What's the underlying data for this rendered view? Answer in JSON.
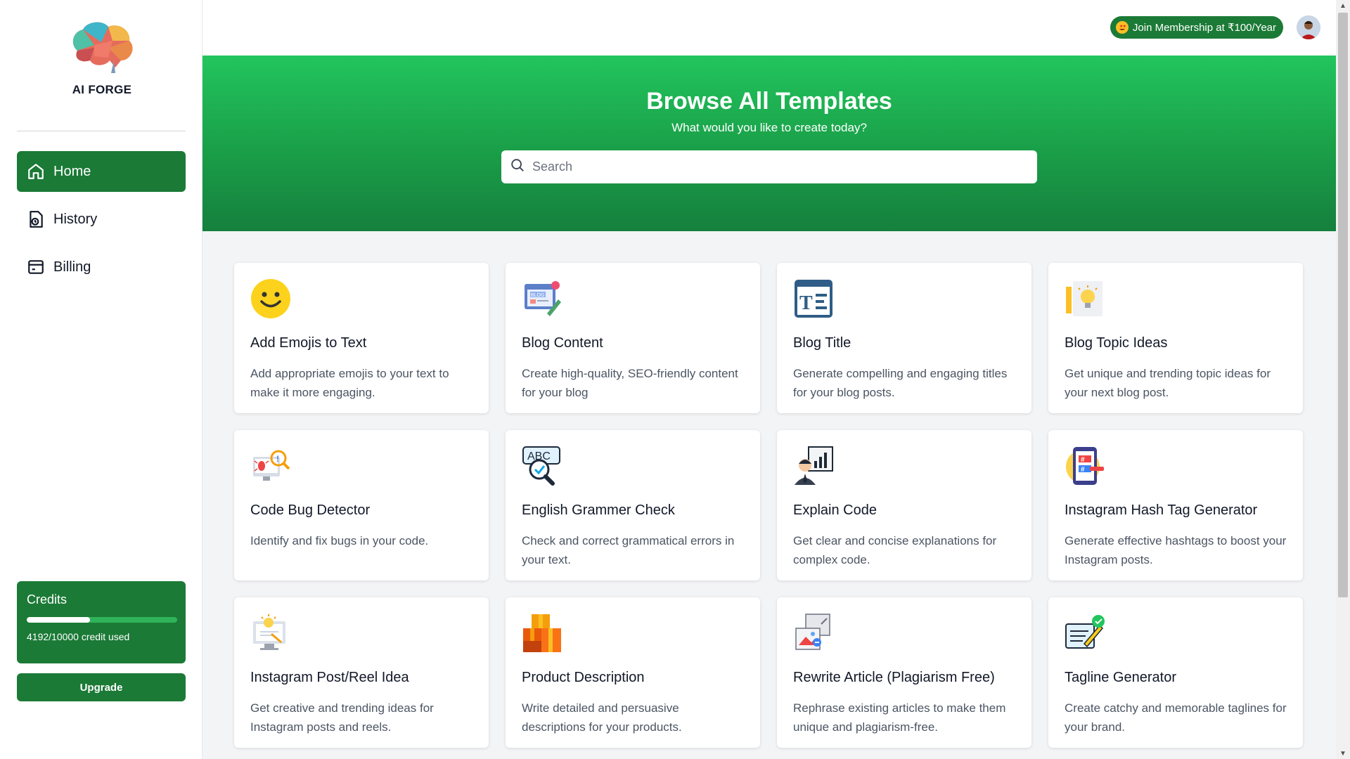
{
  "app": {
    "name": "AI FORGE"
  },
  "sidebar": {
    "items": [
      {
        "label": "Home",
        "icon": "home-icon",
        "active": true
      },
      {
        "label": "History",
        "icon": "history-icon",
        "active": false
      },
      {
        "label": "Billing",
        "icon": "billing-icon",
        "active": false
      }
    ],
    "credits": {
      "title": "Credits",
      "used_text": "4192/10000 credit used",
      "progress": 0.419
    },
    "upgrade_label": "Upgrade"
  },
  "topbar": {
    "membership_label": "Join Membership at ₹100/Year"
  },
  "hero": {
    "title": "Browse All Templates",
    "subtitle": "What would you like to create today?",
    "search_placeholder": "Search"
  },
  "colors": {
    "primary": "#1b7a36",
    "hero_start": "#22c55e",
    "hero_end": "#15803d"
  },
  "templates": [
    {
      "title": "Add Emojis to Text",
      "desc": "Add appropriate emojis to your text to make it more engaging.",
      "icon": "smiley-icon"
    },
    {
      "title": "Blog Content",
      "desc": "Create high-quality, SEO-friendly content for your blog",
      "icon": "blog-icon"
    },
    {
      "title": "Blog Title",
      "desc": "Generate compelling and engaging titles for your blog posts.",
      "icon": "title-icon"
    },
    {
      "title": "Blog Topic Ideas",
      "desc": "Get unique and trending topic ideas for your next blog post.",
      "icon": "lightbulb-icon"
    },
    {
      "title": "Code Bug Detector",
      "desc": "Identify and fix bugs in your code.",
      "icon": "bug-icon"
    },
    {
      "title": "English Grammer Check",
      "desc": "Check and correct grammatical errors in your text.",
      "icon": "abc-magnifier-icon"
    },
    {
      "title": "Explain Code",
      "desc": "Get clear and concise explanations for complex code.",
      "icon": "presenter-icon"
    },
    {
      "title": "Instagram Hash Tag Generator",
      "desc": "Generate effective hashtags to boost your Instagram posts.",
      "icon": "hashtag-icon"
    },
    {
      "title": "Instagram Post/Reel Idea",
      "desc": "Get creative and trending ideas for Instagram posts and reels.",
      "icon": "idea-monitor-icon"
    },
    {
      "title": "Product Description",
      "desc": "Write detailed and persuasive descriptions for your products.",
      "icon": "boxes-icon"
    },
    {
      "title": "Rewrite Article (Plagiarism Free)",
      "desc": "Rephrase existing articles to make them unique and plagiarism-free.",
      "icon": "images-icon"
    },
    {
      "title": "Tagline Generator",
      "desc": "Create catchy and memorable taglines for your brand.",
      "icon": "tagline-icon"
    }
  ]
}
